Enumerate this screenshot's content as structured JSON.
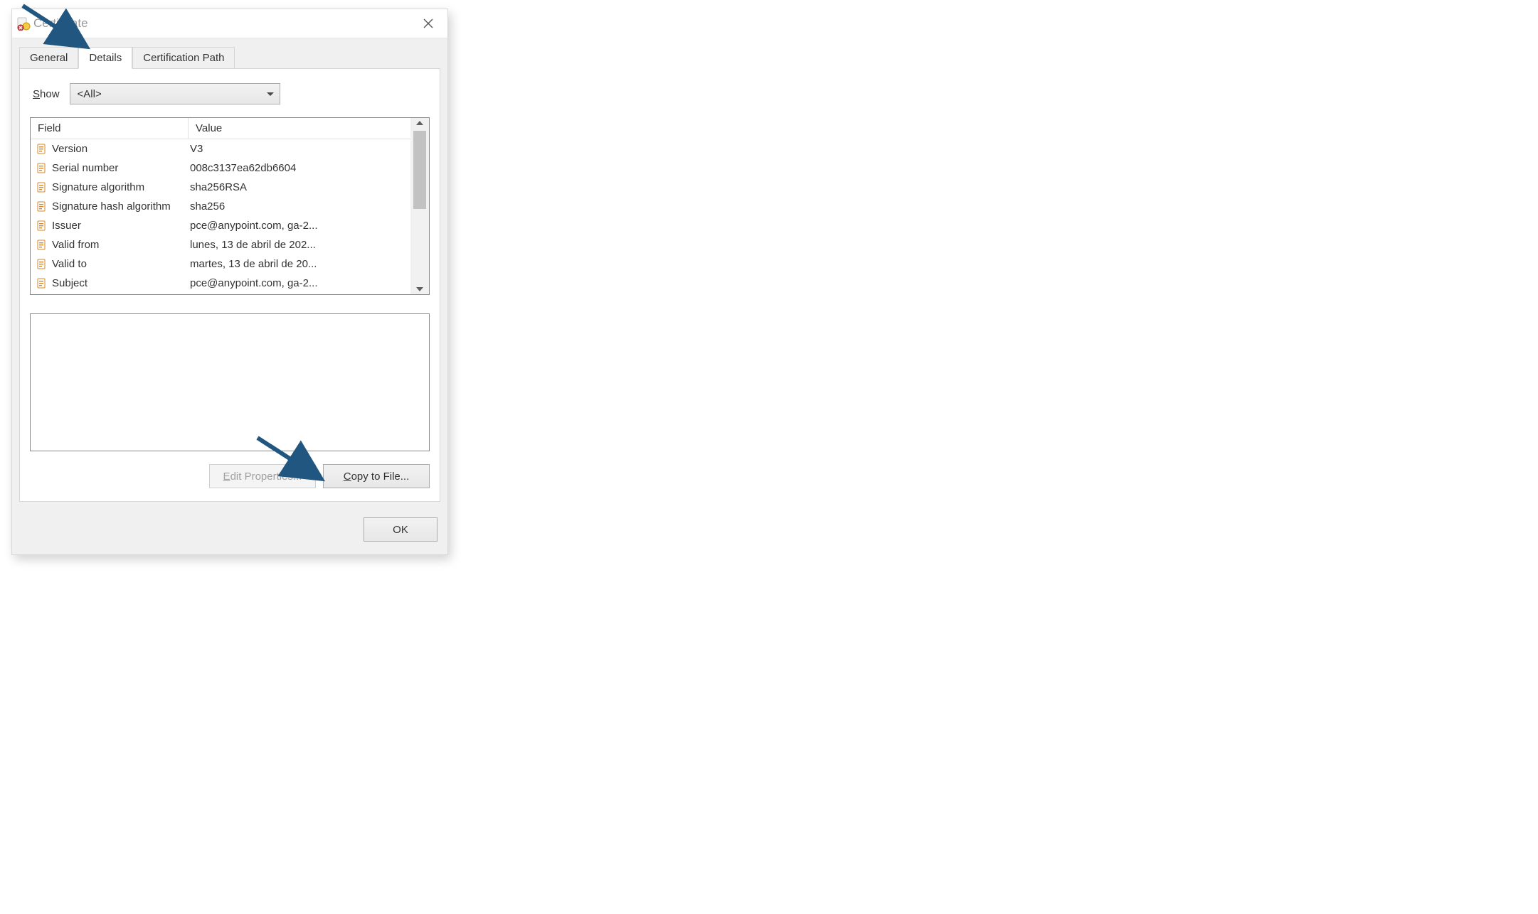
{
  "window": {
    "title": "Certificate"
  },
  "tabs": {
    "general": "General",
    "details": "Details",
    "certpath": "Certification Path"
  },
  "show": {
    "label_pre": "S",
    "label_post": "how",
    "value": "<All>"
  },
  "table": {
    "header_field": "Field",
    "header_value": "Value",
    "rows": [
      {
        "field": "Version",
        "value": "V3"
      },
      {
        "field": "Serial number",
        "value": "008c3137ea62db6604"
      },
      {
        "field": "Signature algorithm",
        "value": "sha256RSA"
      },
      {
        "field": "Signature hash algorithm",
        "value": "sha256"
      },
      {
        "field": "Issuer",
        "value": "pce@anypoint.com, ga-2..."
      },
      {
        "field": "Valid from",
        "value": "lunes, 13 de abril de 202..."
      },
      {
        "field": "Valid to",
        "value": "martes, 13 de abril de 20..."
      },
      {
        "field": "Subject",
        "value": "pce@anypoint.com, ga-2..."
      }
    ]
  },
  "buttons": {
    "edit_pre": "E",
    "edit_post": "dit Properties...",
    "copy_pre": "C",
    "copy_post": "opy to File...",
    "ok": "OK"
  }
}
